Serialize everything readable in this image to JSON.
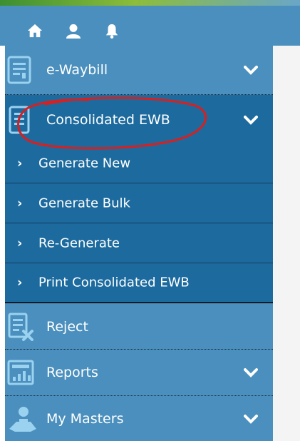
{
  "topbar": {
    "icons": [
      "home-icon",
      "user-icon",
      "bell-icon"
    ]
  },
  "menu": {
    "items": [
      {
        "label": "e-Waybill",
        "icon": "document-icon",
        "expandable": true
      },
      {
        "label": "Consolidated EWB",
        "icon": "document-icon",
        "expandable": true,
        "active": true
      },
      {
        "label": "Reject",
        "icon": "reject-document-icon",
        "expandable": false
      },
      {
        "label": "Reports",
        "icon": "report-icon",
        "expandable": true
      },
      {
        "label": "My Masters",
        "icon": "masters-icon",
        "expandable": true
      }
    ],
    "subitems": [
      {
        "label": "Generate New"
      },
      {
        "label": "Generate Bulk"
      },
      {
        "label": "Re-Generate"
      },
      {
        "label": "Print Consolidated EWB"
      }
    ],
    "sub_prefix": "›"
  },
  "colors": {
    "menu_bg": "#4a8fbd",
    "active_bg": "#1d6b9e",
    "annotation": "#d91f1f"
  }
}
